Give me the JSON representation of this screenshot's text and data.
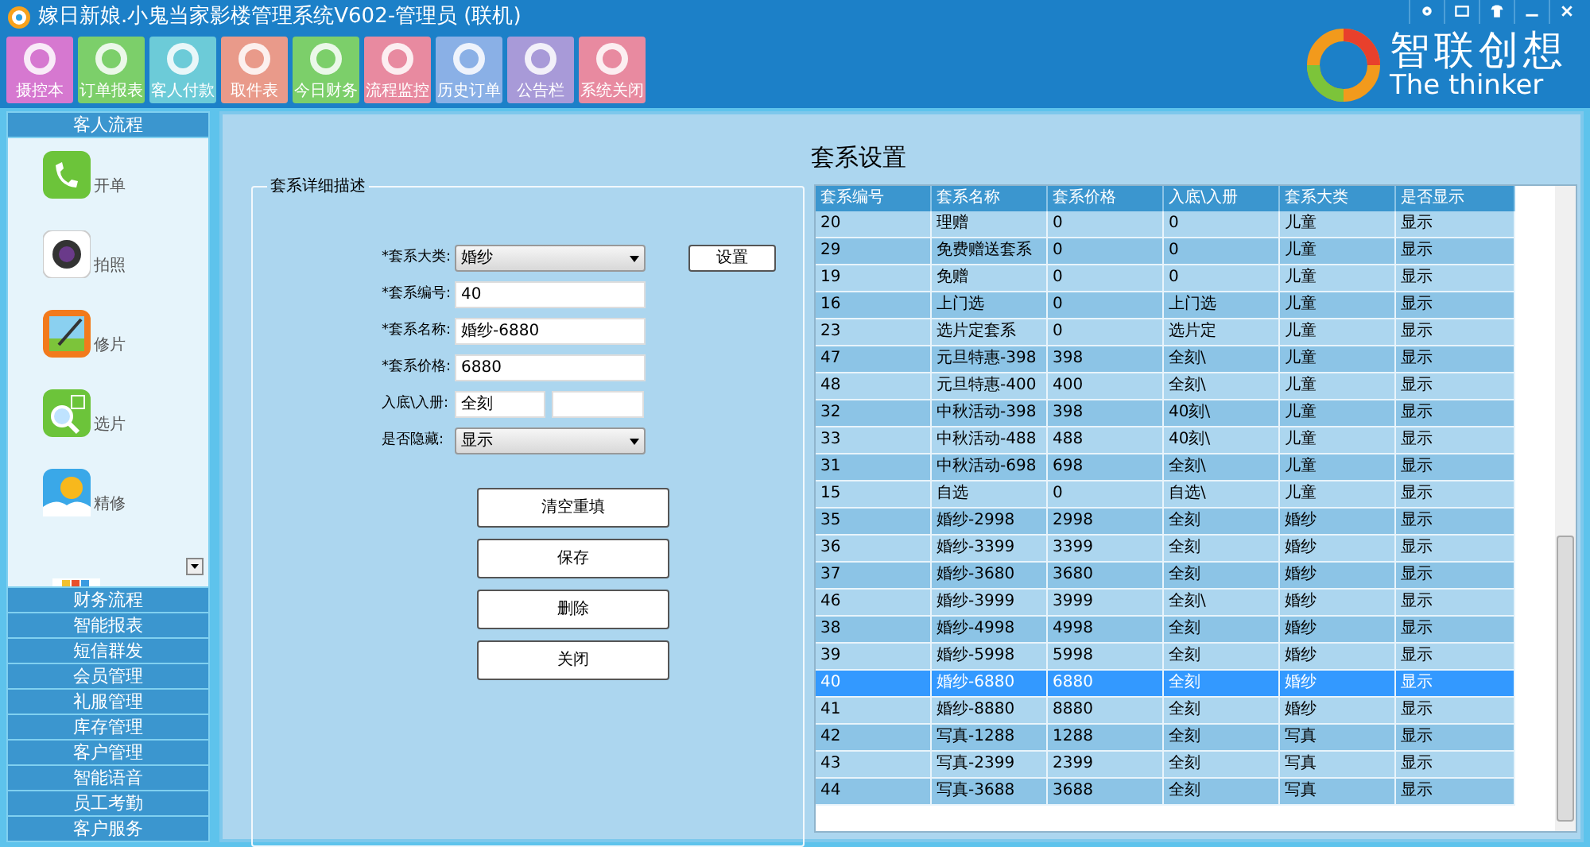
{
  "window": {
    "title": "嫁日新娘.小鬼当家影楼管理系统V602-管理员 (联机)"
  },
  "toolbar": [
    {
      "label": "摄控本",
      "color": "#d678d0"
    },
    {
      "label": "订单报表",
      "color": "#7ccf6a"
    },
    {
      "label": "客人付款",
      "color": "#6ccbd8"
    },
    {
      "label": "取件表",
      "color": "#e99a8a"
    },
    {
      "label": "今日财务",
      "color": "#7ccf6a"
    },
    {
      "label": "流程监控",
      "color": "#e88aa0"
    },
    {
      "label": "历史订单",
      "color": "#8ab0e6"
    },
    {
      "label": "公告栏",
      "color": "#a89ad8"
    },
    {
      "label": "系统关闭",
      "color": "#e88aa0"
    }
  ],
  "logo": {
    "name": "智联创想",
    "tagline": "The thinker"
  },
  "sidebar": {
    "open_section": "客人流程",
    "items": [
      {
        "label": "开单",
        "kind": "phone"
      },
      {
        "label": "拍照",
        "kind": "camera"
      },
      {
        "label": "修片",
        "kind": "edit"
      },
      {
        "label": "选片",
        "kind": "select"
      },
      {
        "label": "精修",
        "kind": "weather"
      }
    ],
    "sections": [
      "财务流程",
      "智能报表",
      "短信群发",
      "会员管理",
      "礼服管理",
      "库存管理",
      "客户管理",
      "智能语音",
      "员工考勤",
      "客户服务"
    ]
  },
  "main": {
    "title": "套系设置",
    "group_title": "套系详细描述",
    "form": [
      {
        "kind": "select",
        "label": "*套系大类:",
        "value": "婚纱"
      },
      {
        "kind": "text",
        "label": "*套系编号:",
        "value": "40"
      },
      {
        "kind": "text",
        "label": "*套系名称:",
        "value": "婚纱-6880"
      },
      {
        "kind": "text",
        "label": "*套系价格:",
        "value": "6880"
      },
      {
        "kind": "pair",
        "label": "入底\\入册:",
        "value": "全刻"
      },
      {
        "kind": "select",
        "label": "是否隐藏:",
        "value": "显示"
      }
    ],
    "set_button": "设置",
    "buttons": [
      "清空重填",
      "保存",
      "删除",
      "关闭"
    ],
    "table": {
      "columns": [
        "套系编号",
        "套系名称",
        "套系价格",
        "入底\\入册",
        "套系大类",
        "是否显示"
      ],
      "rows": [
        {
          "cells": [
            "20",
            "理赠",
            "0",
            "0",
            "儿童",
            "显示"
          ],
          "selected": false
        },
        {
          "cells": [
            "29",
            "免费赠送套系",
            "0",
            "0",
            "儿童",
            "显示"
          ],
          "selected": false
        },
        {
          "cells": [
            "19",
            "免赠",
            "0",
            "0",
            "儿童",
            "显示"
          ],
          "selected": false
        },
        {
          "cells": [
            "16",
            "上门选",
            "0",
            "上门选",
            "儿童",
            "显示"
          ],
          "selected": false
        },
        {
          "cells": [
            "23",
            "选片定套系",
            "0",
            "选片定",
            "儿童",
            "显示"
          ],
          "selected": false
        },
        {
          "cells": [
            "47",
            "元旦特惠-398",
            "398",
            "全刻\\",
            "儿童",
            "显示"
          ],
          "selected": false
        },
        {
          "cells": [
            "48",
            "元旦特惠-400",
            "400",
            "全刻\\",
            "儿童",
            "显示"
          ],
          "selected": false
        },
        {
          "cells": [
            "32",
            "中秋活动-398",
            "398",
            "40刻\\",
            "儿童",
            "显示"
          ],
          "selected": false
        },
        {
          "cells": [
            "33",
            "中秋活动-488",
            "488",
            "40刻\\",
            "儿童",
            "显示"
          ],
          "selected": false
        },
        {
          "cells": [
            "31",
            "中秋活动-698",
            "698",
            "全刻\\",
            "儿童",
            "显示"
          ],
          "selected": false
        },
        {
          "cells": [
            "15",
            "自选",
            "0",
            "自选\\",
            "儿童",
            "显示"
          ],
          "selected": false
        },
        {
          "cells": [
            "35",
            "婚纱-2998",
            "2998",
            "全刻",
            "婚纱",
            "显示"
          ],
          "selected": false
        },
        {
          "cells": [
            "36",
            "婚纱-3399",
            "3399",
            "全刻",
            "婚纱",
            "显示"
          ],
          "selected": false
        },
        {
          "cells": [
            "37",
            "婚纱-3680",
            "3680",
            "全刻",
            "婚纱",
            "显示"
          ],
          "selected": false
        },
        {
          "cells": [
            "46",
            "婚纱-3999",
            "3999",
            "全刻\\",
            "婚纱",
            "显示"
          ],
          "selected": false
        },
        {
          "cells": [
            "38",
            "婚纱-4998",
            "4998",
            "全刻",
            "婚纱",
            "显示"
          ],
          "selected": false
        },
        {
          "cells": [
            "39",
            "婚纱-5998",
            "5998",
            "全刻",
            "婚纱",
            "显示"
          ],
          "selected": false
        },
        {
          "cells": [
            "40",
            "婚纱-6880",
            "6880",
            "全刻",
            "婚纱",
            "显示"
          ],
          "selected": true
        },
        {
          "cells": [
            "41",
            "婚纱-8880",
            "8880",
            "全刻",
            "婚纱",
            "显示"
          ],
          "selected": false
        },
        {
          "cells": [
            "42",
            "写真-1288",
            "1288",
            "全刻",
            "写真",
            "显示"
          ],
          "selected": false
        },
        {
          "cells": [
            "43",
            "写真-2399",
            "2399",
            "全刻",
            "写真",
            "显示"
          ],
          "selected": false
        },
        {
          "cells": [
            "44",
            "写真-3688",
            "3688",
            "全刻",
            "写真",
            "显示"
          ],
          "selected": false
        }
      ]
    }
  }
}
